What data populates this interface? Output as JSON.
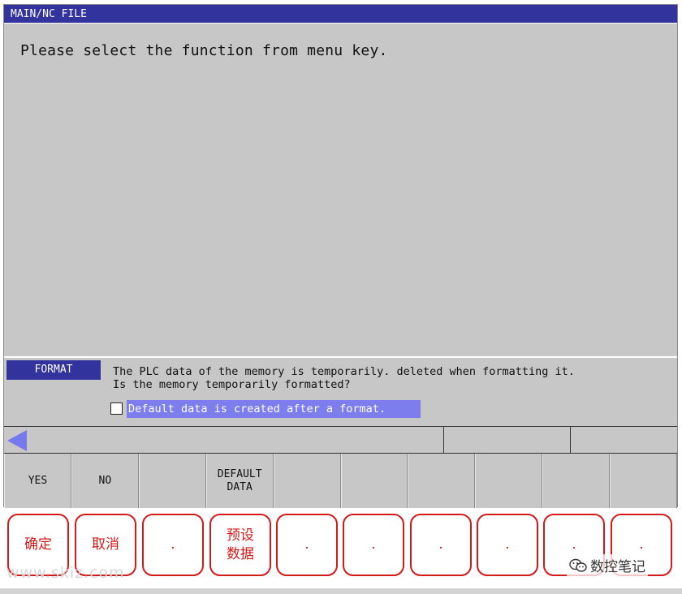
{
  "window": {
    "title": "MAIN/NC FILE"
  },
  "main": {
    "message": "Please select the function from menu key."
  },
  "dialog": {
    "tab_label": "FORMAT",
    "text": "The PLC data of the memory is temporarily. deleted when formatting it.\nIs the memory temporarily formatted?",
    "option_label": "Default data is created after a format.",
    "option_checked": false
  },
  "softkeys": [
    "YES",
    "NO",
    "",
    "DEFAULT\nDATA",
    "",
    "",
    "",
    "",
    "",
    ""
  ],
  "annotations": [
    "确定",
    "取消",
    ".",
    "预设\n数据",
    ".",
    ".",
    ".",
    ".",
    ".",
    "."
  ],
  "watermark": "www.skiz.com",
  "brand": "数控笔记",
  "colors": {
    "title_bg": "#33339e",
    "highlight": "#7d7ded",
    "annotation": "#d41919"
  }
}
